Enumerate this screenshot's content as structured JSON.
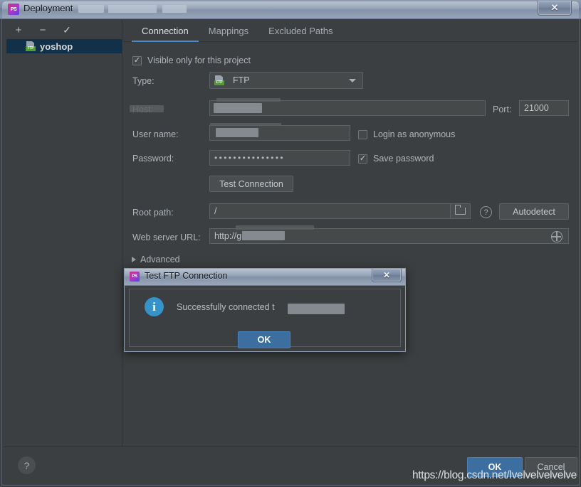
{
  "window": {
    "title": "Deployment",
    "app_icon": "PS",
    "close_label": "✕"
  },
  "sidebar": {
    "toolbar": [
      {
        "name": "add",
        "glyph": "+"
      },
      {
        "name": "remove",
        "glyph": "−"
      },
      {
        "name": "use-as-default",
        "glyph": "✓"
      }
    ],
    "items": [
      {
        "label": "yoshop",
        "type_badge": "FTP"
      }
    ]
  },
  "tabs": [
    {
      "label": "Connection",
      "active": true
    },
    {
      "label": "Mappings",
      "active": false
    },
    {
      "label": "Excluded Paths",
      "active": false
    }
  ],
  "form": {
    "visible_only_label": "Visible only for this project",
    "visible_only_checked": "✓",
    "type_label": "Type:",
    "type_value": "FTP",
    "type_badge": "FTP",
    "host_label": "Host:",
    "host_value": "",
    "port_label": "Port:",
    "port_value": "21000",
    "username_label": "User name:",
    "username_value": "",
    "login_anonymous_label": "Login as anonymous",
    "login_anonymous_checked": "",
    "password_label": "Password:",
    "password_value": "•••••••••••••••",
    "save_password_label": "Save password",
    "save_password_checked": "✓",
    "test_connection_label": "Test Connection",
    "root_path_label": "Root path:",
    "root_path_value": "/",
    "root_path_help": "?",
    "autodetect_label": "Autodetect",
    "web_server_url_label": "Web server URL:",
    "web_server_url_value": "http://g",
    "advanced_label": "Advanced"
  },
  "footer": {
    "help_label": "?",
    "ok_label": "OK",
    "cancel_label": "Cancel"
  },
  "modal": {
    "title": "Test FTP Connection",
    "app_icon": "PS",
    "close_label": "✕",
    "info_glyph": "i",
    "message": "Successfully connected t",
    "ok_label": "OK"
  },
  "watermark": {
    "text": "https://blog.csdn.net/lvelvelvelvelve"
  }
}
